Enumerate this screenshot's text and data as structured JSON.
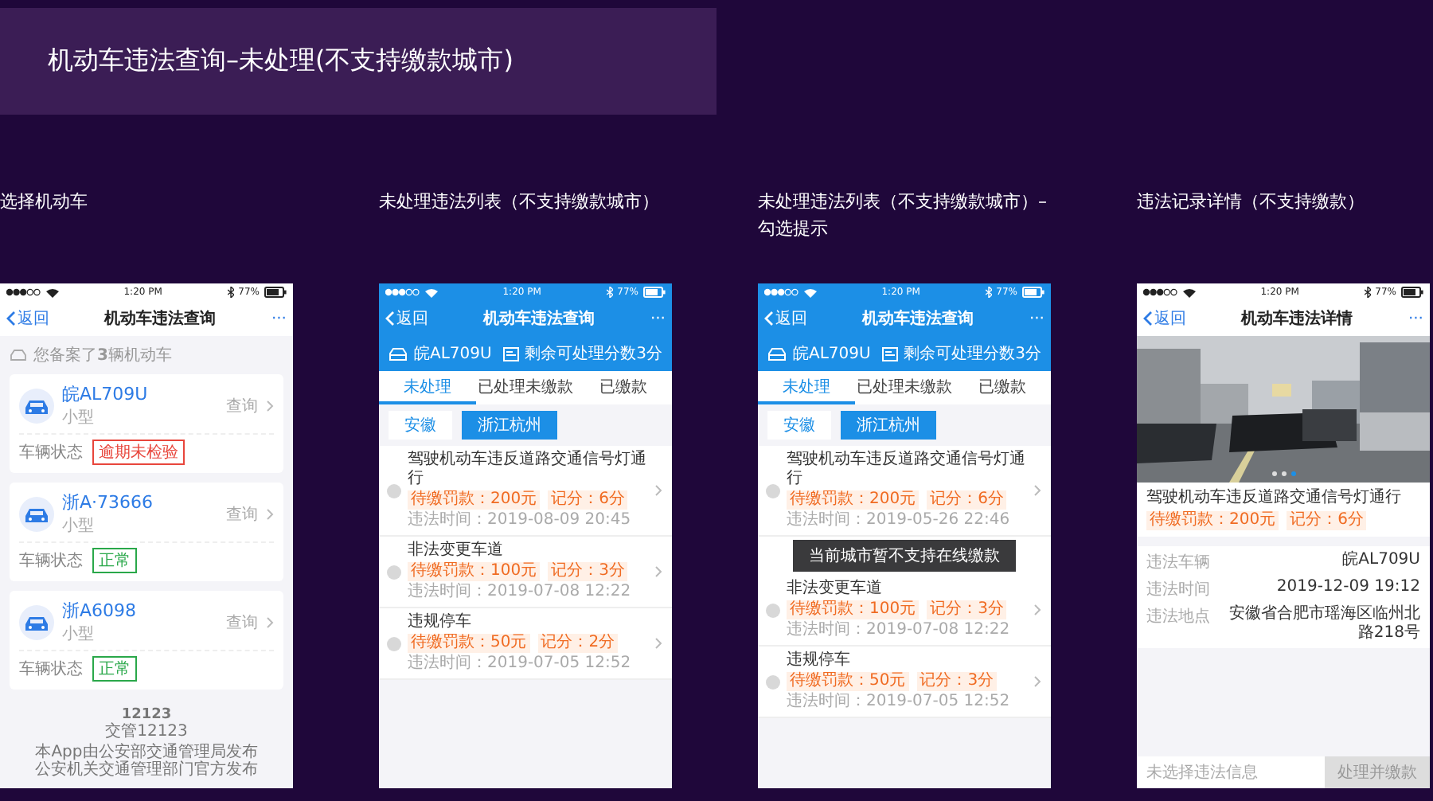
{
  "header": {
    "title": "机动车违法查询–未处理(不支持缴款城市)"
  },
  "screens": [
    {
      "kind": "vehicles",
      "caption": "选择机动车",
      "status": {
        "time": "1:20 PM",
        "battery": "77%"
      },
      "nav": {
        "back": "返回",
        "title": "机动车违法查询",
        "more": "···"
      },
      "summary": "您备案了**3**辆机动车",
      "vehicles": [
        {
          "plate": "皖AL709U",
          "type": "小型",
          "action": "查询",
          "status_label": "车辆状态",
          "status": "逾期未检验",
          "color": "#e8463c"
        },
        {
          "plate": "浙A·73666",
          "type": "小型",
          "action": "查询",
          "status_label": "车辆状态",
          "status": "正常",
          "color": "#2aa84a"
        },
        {
          "plate": "浙A6098",
          "type": "小型",
          "action": "查询",
          "status_label": "车辆状态",
          "status": "正常",
          "color": "#2aa84a"
        }
      ],
      "footer": {
        "logo": "12123",
        "logo_sub": "交管12123",
        "lines": [
          "本App由公安部交通管理局发布",
          "公安机关交通管理部门官方发布"
        ]
      }
    },
    {
      "kind": "violations",
      "caption": "未处理违法列表（不支持缴款城市）",
      "status": {
        "time": "1:20 PM",
        "battery": "77%"
      },
      "nav": {
        "back": "返回",
        "title": "机动车违法查询",
        "more": "···"
      },
      "plate": "皖AL709U",
      "points_left": "剩余可处理分数3分",
      "tabs": [
        {
          "label": "未处理",
          "selected": true
        },
        {
          "label": "已处理未缴款",
          "selected": false
        },
        {
          "label": "已缴款",
          "selected": false
        }
      ],
      "filters": [
        {
          "label": "安徽",
          "selected": false
        },
        {
          "label": "浙江杭州",
          "selected": true
        }
      ],
      "items": [
        {
          "title": "驾驶机动车违反道路交通信号灯通行",
          "fine": "待缴罚款：200元",
          "points": "记分：6分",
          "time": "违法时间：2019-08-09 20:45",
          "checked": false
        },
        {
          "title": "非法变更车道",
          "fine": "待缴罚款：100元",
          "points": "记分：3分",
          "time": "违法时间：2019-07-08 12:22",
          "checked": false
        },
        {
          "title": "违规停车",
          "fine": "待缴罚款：50元",
          "points": "记分：2分",
          "time": "违法时间：2019-07-05 12:52",
          "checked": false
        }
      ]
    },
    {
      "kind": "violations",
      "caption": "未处理违法列表（不支持缴款城市）–勾选提示",
      "status": {
        "time": "1:20 PM",
        "battery": "77%"
      },
      "nav": {
        "back": "返回",
        "title": "机动车违法查询",
        "more": "···"
      },
      "plate": "皖AL709U",
      "points_left": "剩余可处理分数3分",
      "tabs": [
        {
          "label": "未处理",
          "selected": true
        },
        {
          "label": "已处理未缴款",
          "selected": false
        },
        {
          "label": "已缴款",
          "selected": false
        }
      ],
      "filters": [
        {
          "label": "安徽",
          "selected": false
        },
        {
          "label": "浙江杭州",
          "selected": true
        }
      ],
      "items": [
        {
          "title": "驾驶机动车违反道路交通信号灯通行",
          "fine": "待缴罚款：200元",
          "points": "记分：6分",
          "time": "违法时间：2019-05-26 22:46",
          "checked": false
        },
        {
          "title": "非法变更车道",
          "fine": "待缴罚款：100元",
          "points": "记分：3分",
          "time": "违法时间：2019-07-08 12:22",
          "checked": false
        },
        {
          "title": "违规停车",
          "fine": "待缴罚款：50元",
          "points": "记分：3分",
          "time": "违法时间：2019-07-05 12:52",
          "checked": false
        }
      ],
      "toast": "当前城市暂不支持在线缴款"
    },
    {
      "kind": "detail",
      "caption": "违法记录详情（不支持缴款）",
      "status": {
        "time": "1:20 PM",
        "battery": "77%"
      },
      "nav": {
        "back": "返回",
        "title": "机动车违法详情",
        "more": "···"
      },
      "photo": {
        "dots": [
          {
            "selected": false
          },
          {
            "selected": false
          },
          {
            "selected": true
          }
        ]
      },
      "title": "驾驶机动车违反道路交通信号灯通行",
      "fine": "待缴罚款：200元",
      "points": "记分：6分",
      "rows": [
        {
          "label": "违法车辆",
          "value": "皖AL709U"
        },
        {
          "label": "违法时间",
          "value": "2019-12-09  19:12"
        },
        {
          "label": "违法地点",
          "value": "安徽省合肥市瑶海区临州北路218号"
        }
      ],
      "bottom": {
        "hint": "未选择违法信息",
        "button": "处理并缴款",
        "disabled": true
      }
    }
  ]
}
